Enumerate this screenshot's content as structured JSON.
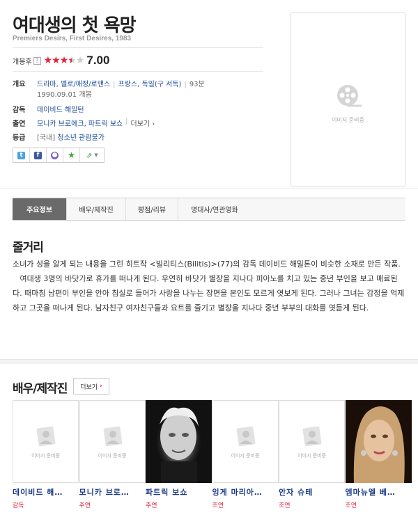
{
  "movie": {
    "title": "여대생의 첫 욕망",
    "subtitle": "Premiers Desirs, First Desires, 1983",
    "rating_label": "개봉후",
    "rating_help": "?",
    "stars_value": 3.5,
    "stars_max": 5,
    "score": "7.00"
  },
  "info": {
    "overview_label": "개요",
    "genres": "드라마, 멜로/애정/로맨스",
    "country": "프랑스, 독일(구 서독)",
    "runtime": "93분",
    "release": "1990.09.01 개봉",
    "director_label": "감독",
    "director": "데이비드 해밀턴",
    "cast_label": "출연",
    "cast": "모니카 브로에크, 파트릭 보쇼",
    "cast_more": "더보기",
    "grade_label": "등급",
    "grade_prefix": "[국내]",
    "grade": "청소년 관람불가"
  },
  "share": {
    "twitter": "twitter-icon",
    "facebook": "facebook-icon",
    "me2day": "me2day-icon",
    "favorite": "star-icon",
    "more": "share-icon"
  },
  "poster": {
    "placeholder": "이미지 준비중"
  },
  "tabs": [
    "주요정보",
    "배우/제작진",
    "평점/리뷰",
    "명대사/연관영화"
  ],
  "plot": {
    "heading": "줄거리",
    "p1": "소녀가 성을 알게 되는 내용을 그린 히트작 <빌리티스(Bilitis)>(77)의 감독 데이비드 해밀톤이 비슷한 소재로 만든 작품.",
    "p2": "   여대생 3명의 바닷가로 휴가를 떠나게 된다. 우연히 바닷가 별장을 지나다 피아노를 치고 있는 중년 부인을 보고 매료된다. 때마침 남편이 부인을 안아 침실로 들어가 사랑을 나누는 장면을 본인도 모르게 엿보게 된다. 그러나 그녀는 감정을 억제하고 그곳을 떠나게 된다. 남자친구 여자친구들과 요트를 즐기고 별장을 지나다 중년 부부의 대화를 엿듣게 된다."
  },
  "cast_section": {
    "heading": "배우/제작진",
    "more": "더보기",
    "placeholder": "이미지 준비중",
    "people": [
      {
        "name": "데이비드 해…",
        "role": "감독",
        "photo": false
      },
      {
        "name": "모니카 브로…",
        "role": "주연",
        "photo": false
      },
      {
        "name": "파트릭 보쇼",
        "role": "주연",
        "photo": true
      },
      {
        "name": "잉게 마리아…",
        "role": "조연",
        "photo": false
      },
      {
        "name": "안자 슈테",
        "role": "조연",
        "photo": false
      },
      {
        "name": "엠마뉴엘 베…",
        "role": "조연",
        "photo": true
      }
    ]
  },
  "colors": {
    "accent": "#e8203a",
    "link": "#1a4a9a",
    "tab_active": "#6a6a6a"
  }
}
